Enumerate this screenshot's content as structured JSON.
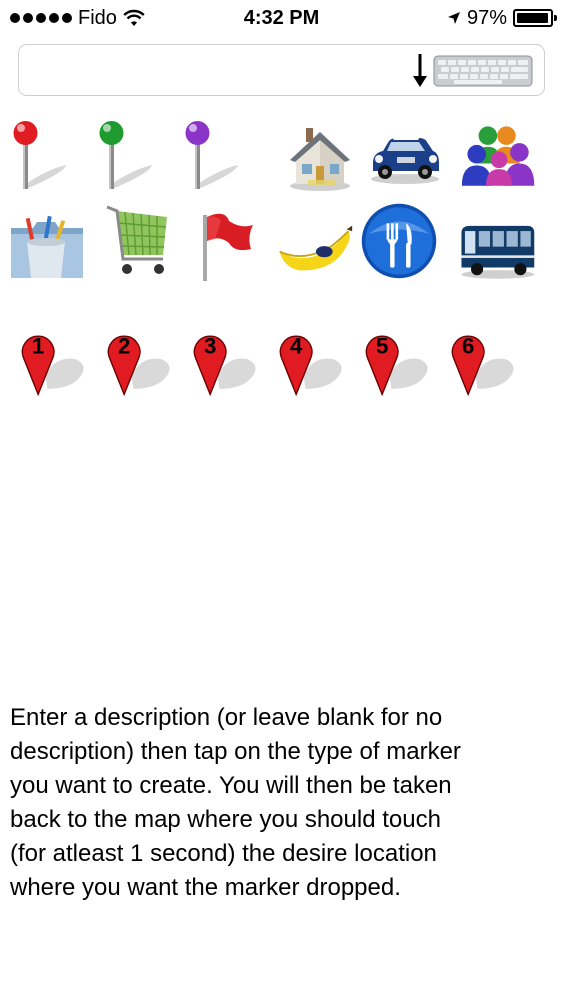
{
  "status_bar": {
    "carrier": "Fido",
    "time": "4:32 PM",
    "battery_percent": "97%",
    "battery_level": 0.97,
    "signal_bars": 5,
    "icons": [
      "wifi-icon",
      "location-arrow-icon",
      "battery-icon"
    ]
  },
  "description_field": {
    "value": "",
    "placeholder": "",
    "keyboard_dismiss_icon": "keyboard-dismiss-icon"
  },
  "marker_rows": [
    [
      {
        "id": "red-pin",
        "icon": "red-pin-icon"
      },
      {
        "id": "green-pin",
        "icon": "green-pin-icon"
      },
      {
        "id": "purple-pin",
        "icon": "purple-pin-icon"
      },
      {
        "id": "house",
        "icon": "house-icon"
      },
      {
        "id": "car",
        "icon": "car-icon"
      },
      {
        "id": "people",
        "icon": "people-group-icon"
      }
    ],
    [
      {
        "id": "folder",
        "icon": "folder-pencils-icon"
      },
      {
        "id": "cart",
        "icon": "shopping-cart-icon"
      },
      {
        "id": "flag",
        "icon": "flag-icon"
      },
      {
        "id": "banana",
        "icon": "banana-icon"
      },
      {
        "id": "restaurant",
        "icon": "fork-knife-icon"
      },
      {
        "id": "bus",
        "icon": "bus-icon"
      }
    ],
    [
      {
        "id": "marker-1",
        "icon": "numbered-marker-icon",
        "label": "1"
      },
      {
        "id": "marker-2",
        "icon": "numbered-marker-icon",
        "label": "2"
      },
      {
        "id": "marker-3",
        "icon": "numbered-marker-icon",
        "label": "3"
      },
      {
        "id": "marker-4",
        "icon": "numbered-marker-icon",
        "label": "4"
      },
      {
        "id": "marker-5",
        "icon": "numbered-marker-icon",
        "label": "5"
      },
      {
        "id": "marker-6",
        "icon": "numbered-marker-icon",
        "label": "6"
      }
    ]
  ],
  "colors": {
    "marker_red": "#e11b22",
    "pin_green": "#1e9a2e",
    "pin_purple": "#8a35c8",
    "restaurant_blue": "#1e6fd9",
    "bus_blue": "#123a66"
  },
  "instructions": "Enter a description (or leave blank for no\ndescription) then tap on the type of marker\nyou want to create.  You will then be taken\nback to the map where you should touch\n(for atleast 1 second) the desire location\nwhere you want the marker dropped."
}
